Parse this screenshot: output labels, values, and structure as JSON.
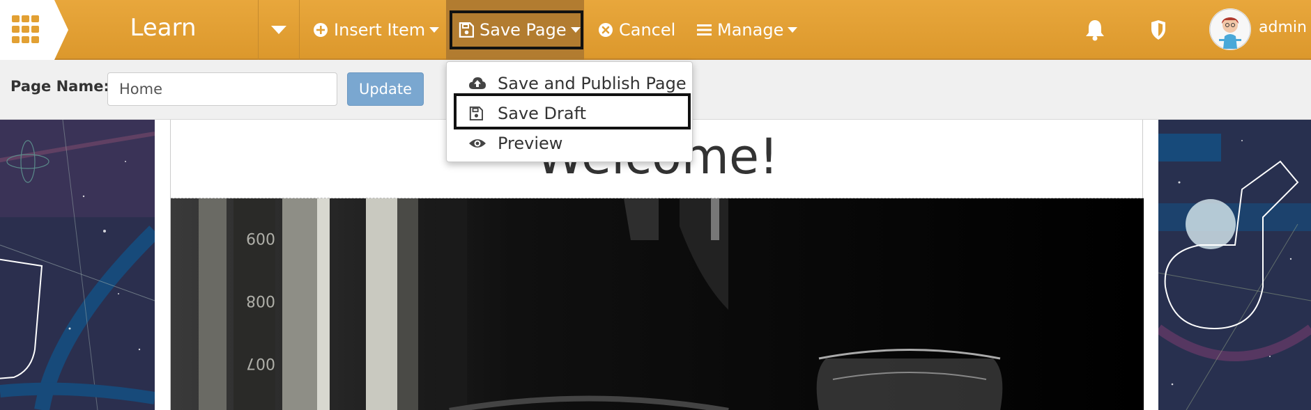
{
  "topbar": {
    "app_title": "Learn",
    "insert_item_label": "Insert Item",
    "save_page_label": "Save Page",
    "cancel_label": "Cancel",
    "manage_label": "Manage",
    "user_name": "admin",
    "bar_color": "#e2a033",
    "active_color": "#b27c30"
  },
  "save_menu": {
    "items": [
      {
        "label": "Save and Publish Page",
        "icon": "cloud-upload-icon"
      },
      {
        "label": "Save Draft",
        "icon": "floppy-disk-icon",
        "highlighted": true
      },
      {
        "label": "Preview",
        "icon": "eye-icon"
      }
    ]
  },
  "page_name_bar": {
    "label": "Page Name:",
    "value": "Home",
    "update_label": "Update"
  },
  "page": {
    "heading": "Welcome!"
  }
}
